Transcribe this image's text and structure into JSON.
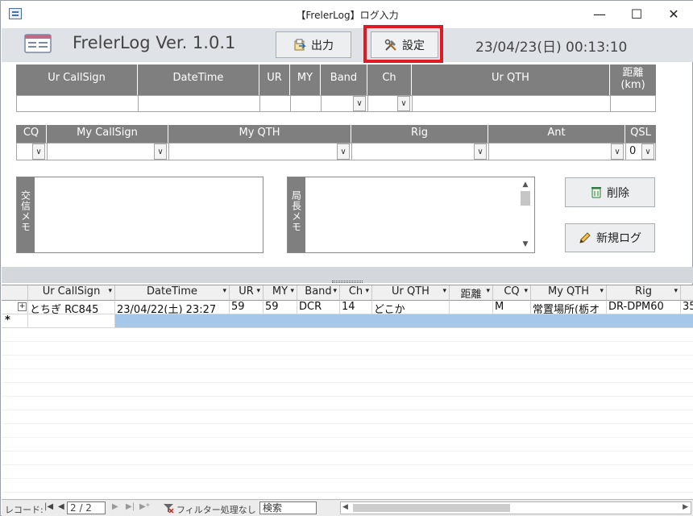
{
  "window": {
    "title": "【FrelerLog】ログ入力",
    "minimize": "—",
    "maximize": "☐",
    "close": "✕"
  },
  "header": {
    "app_name": "FrelerLog  Ver. 1.0.1",
    "output_label": "出力",
    "settings_label": "設定",
    "clock": "23/04/23(日) 00:13:10"
  },
  "form1": {
    "headers": [
      "Ur CallSign",
      "DateTime",
      "UR",
      "MY",
      "Band",
      "Ch",
      "Ur QTH",
      "距離\n(km)"
    ]
  },
  "form2": {
    "headers": [
      "CQ",
      "My CallSign",
      "My QTH",
      "Rig",
      "Ant",
      "QSL"
    ],
    "qsl_value": "0"
  },
  "memo": {
    "contact_label": "交信メモ",
    "chief_label": "局長メモ"
  },
  "buttons": {
    "delete_label": "削除",
    "new_log_label": "新規ログ"
  },
  "sheet": {
    "columns": [
      "Ur CallSign",
      "DateTime",
      "UR",
      "MY",
      "Band",
      "Ch",
      "Ur QTH",
      "距離",
      "CQ",
      "My QTH",
      "Rig",
      ""
    ],
    "rows": [
      [
        "とちぎ RC845",
        "23/04/22(土) 23:27",
        "59",
        "59",
        "DCR",
        "14",
        "どこか",
        "",
        "M",
        "常置場所(栃オ",
        "DR-DPM60",
        "35"
      ]
    ],
    "new_row_marker": "*",
    "expand_marker": "+"
  },
  "status": {
    "record_label": "レコード:",
    "record_value": "2 / 2",
    "filter_label": "フィルター処理なし",
    "search_label": "検索"
  },
  "colors": {
    "header_gray": "#7f7f7f",
    "highlight": "#e01a24",
    "new_row": "#a5c8e8"
  }
}
